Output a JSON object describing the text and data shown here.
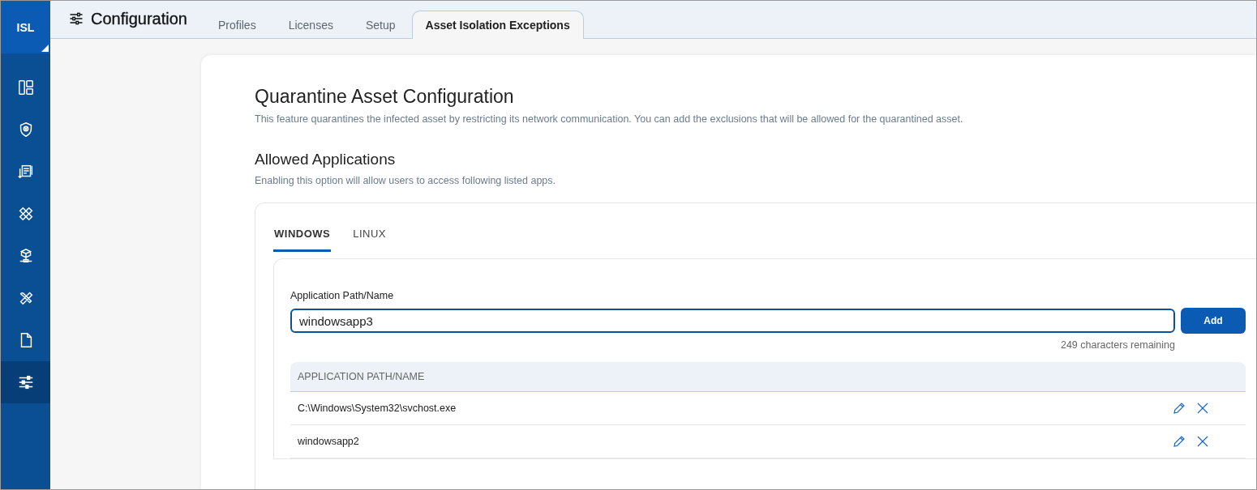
{
  "sidebar": {
    "logo": "ISL",
    "items": [
      {
        "kind": "dashboard",
        "selected": false
      },
      {
        "kind": "shield",
        "selected": false
      },
      {
        "kind": "report",
        "selected": false
      },
      {
        "kind": "patch",
        "selected": false
      },
      {
        "kind": "network",
        "selected": false
      },
      {
        "kind": "tools",
        "selected": false
      },
      {
        "kind": "document",
        "selected": false
      },
      {
        "kind": "sliders",
        "selected": true
      }
    ]
  },
  "header": {
    "title": "Configuration",
    "tabs": [
      {
        "label": "Profiles",
        "selected": false
      },
      {
        "label": "Licenses",
        "selected": false
      },
      {
        "label": "Setup",
        "selected": false
      },
      {
        "label": "Asset Isolation Exceptions",
        "selected": true
      }
    ]
  },
  "page": {
    "title": "Quarantine Asset Configuration",
    "description": "This feature quarantines the infected asset by restricting its network communication. You can add the exclusions that will be allowed for the quarantined asset.",
    "section_title": "Allowed Applications",
    "section_description": "Enabling this option will allow users to access following listed apps.",
    "os_tabs": [
      {
        "label": "WINDOWS",
        "selected": true
      },
      {
        "label": "LINUX",
        "selected": false
      }
    ],
    "field": {
      "label": "Application Path/Name",
      "value": "windowsapp3",
      "counter": "249 characters remaining"
    },
    "add_button": "Add",
    "table": {
      "columns": [
        "APPLICATION PATH/NAME"
      ],
      "rows": [
        {
          "path": "C:\\Windows\\System32\\svchost.exe"
        },
        {
          "path": "windowsapp2"
        }
      ]
    }
  }
}
